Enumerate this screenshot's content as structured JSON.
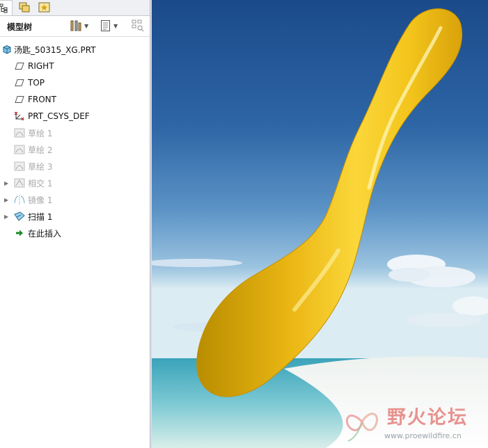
{
  "panel": {
    "title": "模型树",
    "tabs": [
      "model-tree-tab",
      "layers-tab",
      "favorites-tab"
    ]
  },
  "tree": {
    "root": "汤匙_50315_XG.PRT",
    "items": [
      {
        "label": "RIGHT",
        "icon": "datum-plane-icon",
        "dim": false,
        "expandable": false
      },
      {
        "label": "TOP",
        "icon": "datum-plane-icon",
        "dim": false,
        "expandable": false
      },
      {
        "label": "FRONT",
        "icon": "datum-plane-icon",
        "dim": false,
        "expandable": false
      },
      {
        "label": "PRT_CSYS_DEF",
        "icon": "csys-icon",
        "dim": false,
        "expandable": false
      },
      {
        "label": "草绘 1",
        "icon": "sketch-icon",
        "dim": true,
        "expandable": false
      },
      {
        "label": "草绘 2",
        "icon": "sketch-icon",
        "dim": true,
        "expandable": false
      },
      {
        "label": "草绘 3",
        "icon": "sketch-icon",
        "dim": true,
        "expandable": false
      },
      {
        "label": "相交 1",
        "icon": "intersect-icon",
        "dim": true,
        "expandable": true
      },
      {
        "label": "镜像 1",
        "icon": "mirror-icon",
        "dim": true,
        "expandable": true
      },
      {
        "label": "扫描 1",
        "icon": "sweep-icon",
        "dim": false,
        "expandable": true
      },
      {
        "label": "在此插入",
        "icon": "insert-here-arrow-icon",
        "dim": false,
        "expandable": false
      }
    ]
  },
  "watermark": {
    "title": "野火论坛",
    "url": "www.proewildfire.cn"
  },
  "colors": {
    "spoon": "#f2c81c",
    "sky_top": "#1e4f8f",
    "sea": "#4fb3c4",
    "insert_arrow": "#1c8a2a"
  }
}
